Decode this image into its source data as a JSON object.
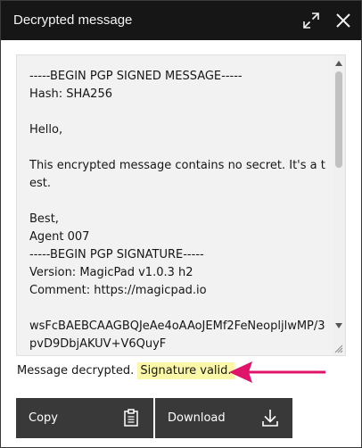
{
  "window": {
    "title": "Decrypted message",
    "maximize_icon": "maximize-icon",
    "close_icon": "close-icon"
  },
  "message": {
    "text": "-----BEGIN PGP SIGNED MESSAGE-----\nHash: SHA256\n\nHello,\n\nThis encrypted message contains no secret. It's a test.\n\nBest,\nAgent 007\n-----BEGIN PGP SIGNATURE-----\nVersion: MagicPad v1.0.3 h2\nComment: https://magicpad.io\n\nwsFcBAEBCAAGBQJeAe4oAAoJEMf2FeNeopljlwMP/3pvD9DbjAKUV+V6QuyF",
    "scroll_up_icon": "triangle-up-icon",
    "scroll_down_icon": "triangle-down-icon"
  },
  "status": {
    "decrypted": "Message decrypted.",
    "signature": "Signature valid."
  },
  "annotation": {
    "arrow_color": "#e0146a"
  },
  "actions": {
    "copy_label": "Copy",
    "copy_icon": "clipboard-icon",
    "download_label": "Download",
    "download_icon": "download-icon"
  },
  "colors": {
    "titlebar": "#161616",
    "button": "#393939",
    "highlight": "#fbf7a8"
  }
}
